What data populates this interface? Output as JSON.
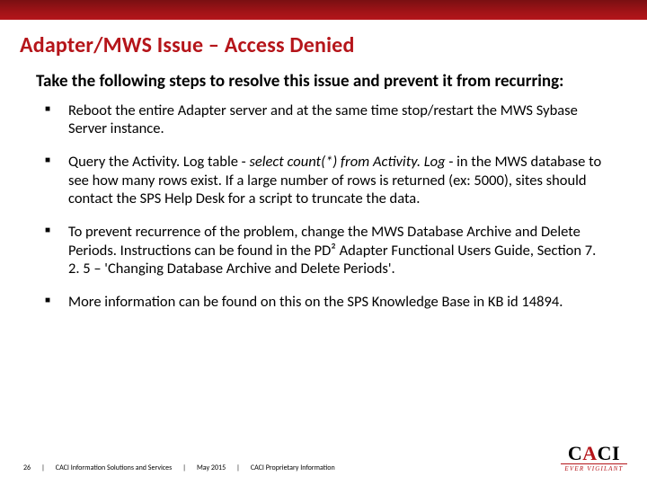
{
  "title": "Adapter/MWS Issue – Access Denied",
  "intro": "Take the following steps to resolve this issue and prevent it from recurring:",
  "bullets": [
    {
      "pre": "Reboot the entire Adapter server and at the same time stop/restart the MWS Sybase Server instance.",
      "italic": "",
      "post": ""
    },
    {
      "pre": "Query the Activity. Log table - ",
      "italic": "select count(*) from Activity. Log",
      "post": " -  in the MWS database to see how many rows exist.  If a large number of rows is returned (ex: 5000), sites should contact the SPS Help Desk for a script to truncate the data."
    },
    {
      "pre": "To prevent recurrence of the problem, change the MWS Database Archive and Delete Periods.  Instructions can be found in the PD² Adapter Functional Users Guide,  Section 7. 2. 5 – 'Changing Database Archive and Delete Periods'.",
      "italic": "",
      "post": ""
    },
    {
      "pre": "More information can be found on this on the SPS Knowledge Base in KB id 14894.",
      "italic": "",
      "post": ""
    }
  ],
  "footer": {
    "page": "26",
    "org": "CACI Information Solutions and Services",
    "date": "May 2015",
    "class": "CACI Proprietary Information"
  },
  "logo": {
    "c": "C",
    "a1": "A",
    "c2": "C",
    "i": "I",
    "tagline": "EVER VIGILANT"
  }
}
